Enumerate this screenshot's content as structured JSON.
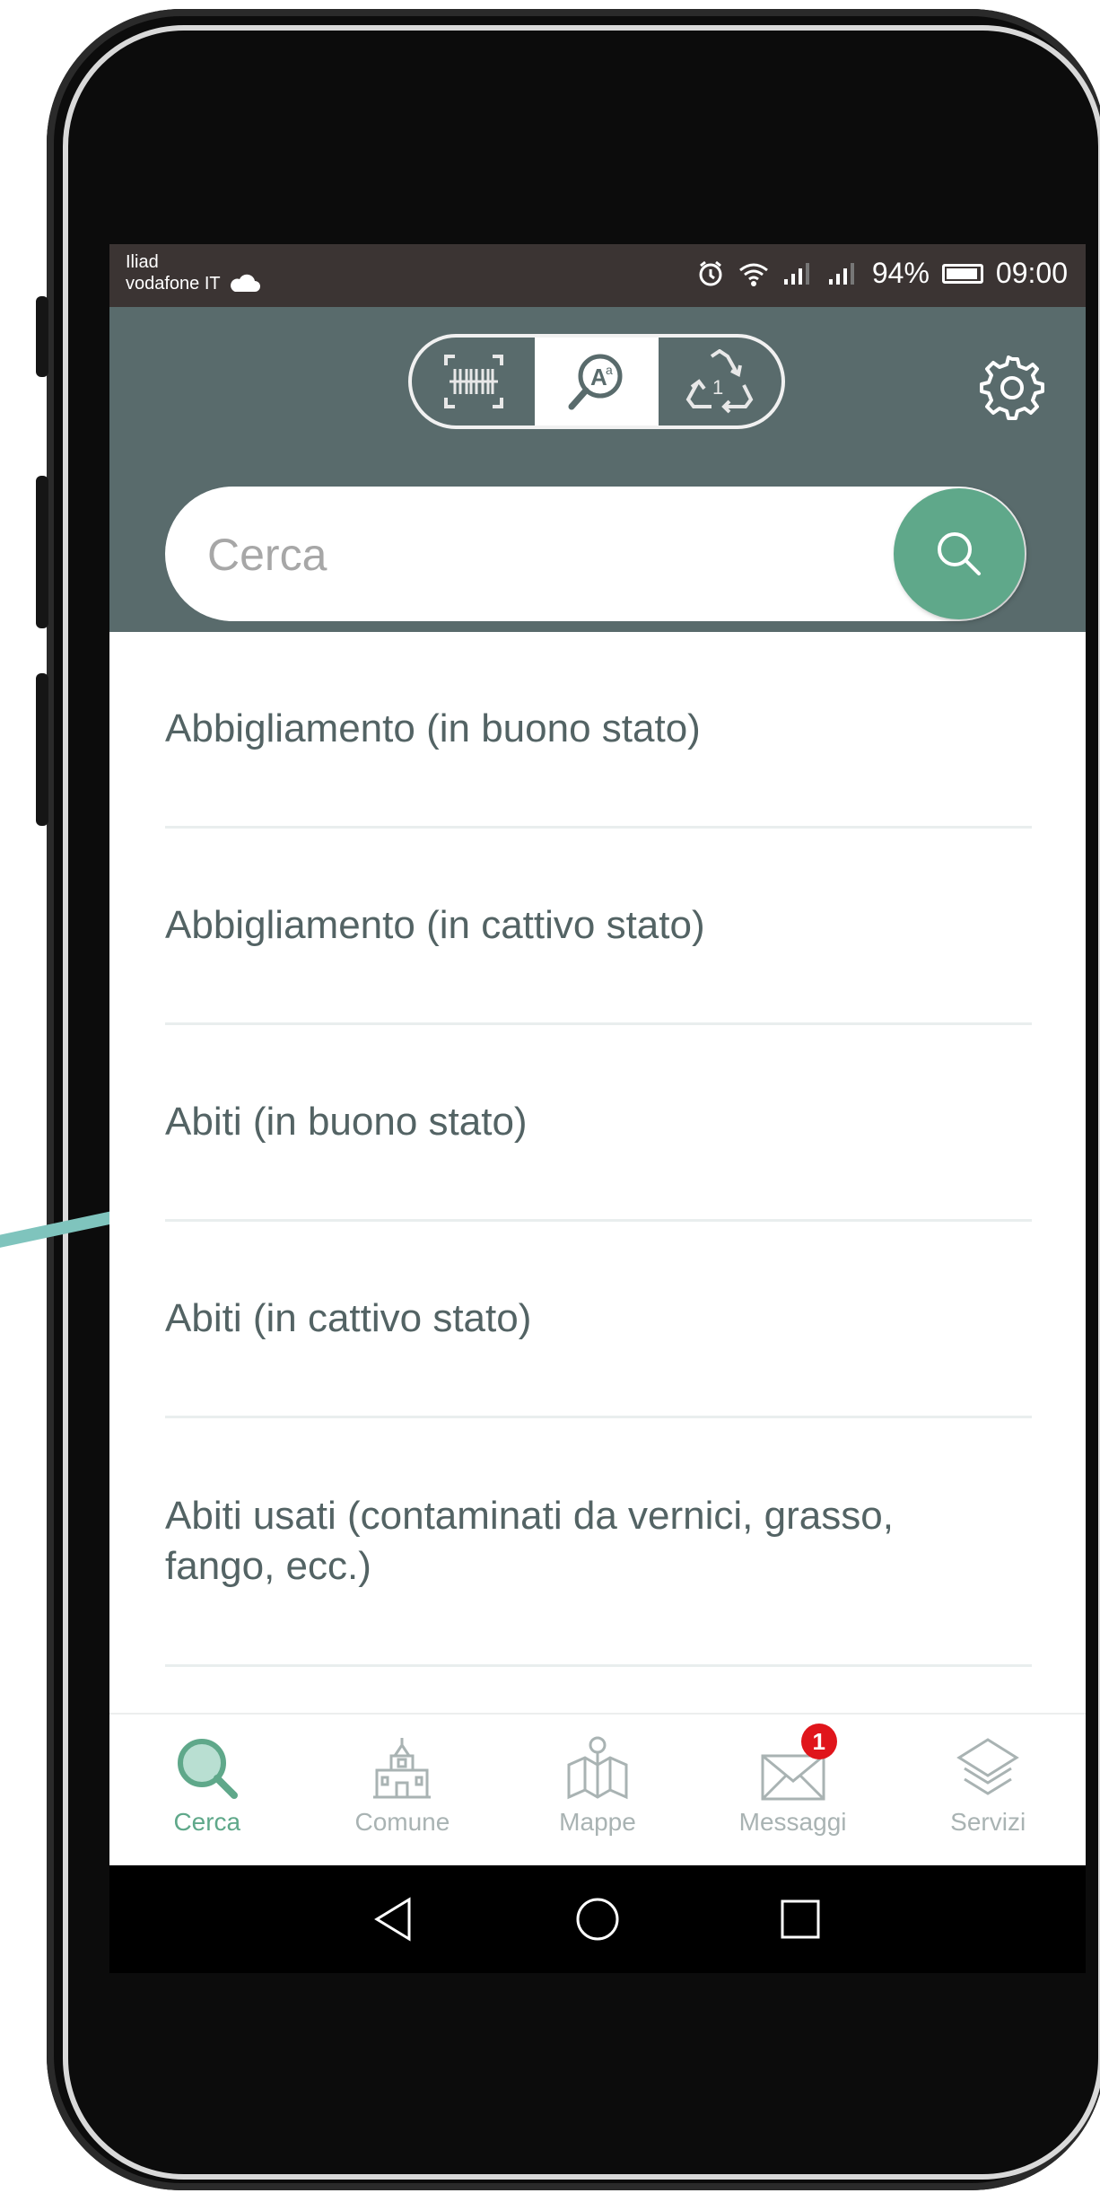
{
  "status_bar": {
    "carrier_line1": "Iliad",
    "carrier_line2": "vodafone IT",
    "battery_percent": "94%",
    "time": "09:00"
  },
  "header": {
    "mode_tabs": [
      {
        "icon": "barcode-icon",
        "active": false
      },
      {
        "icon": "text-search-icon",
        "active": true
      },
      {
        "icon": "recycle-icon",
        "active": false
      }
    ],
    "settings_icon": "gear-icon"
  },
  "search": {
    "placeholder": "Cerca",
    "value": ""
  },
  "results": [
    {
      "label": "Abbigliamento (in buono stato)"
    },
    {
      "label": "Abbigliamento (in cattivo stato)"
    },
    {
      "label": "Abiti (in buono stato)"
    },
    {
      "label": "Abiti (in cattivo stato)"
    },
    {
      "label": "Abiti usati (contaminati da vernici, grasso, fango, ecc.)"
    }
  ],
  "tabbar": {
    "items": [
      {
        "label": "Cerca",
        "icon": "search-icon",
        "active": true
      },
      {
        "label": "Comune",
        "icon": "town-hall-icon",
        "active": false
      },
      {
        "label": "Mappe",
        "icon": "map-icon",
        "active": false
      },
      {
        "label": "Messaggi",
        "icon": "mail-icon",
        "active": false,
        "badge": "1"
      },
      {
        "label": "Servizi",
        "icon": "layers-icon",
        "active": false
      }
    ]
  },
  "colors": {
    "header": "#596b6c",
    "accent": "#5fa88a",
    "badge": "#e0151b",
    "status_bar": "#3b3433",
    "list_text": "#536364"
  }
}
